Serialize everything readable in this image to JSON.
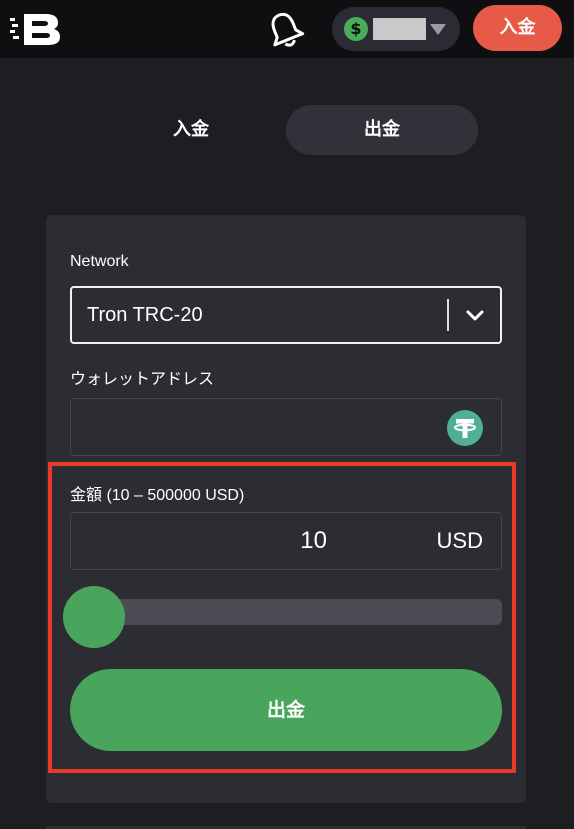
{
  "header": {
    "logo_icon": "brand-logo-icon",
    "bell_icon": "bell-icon",
    "balance": {
      "currency_icon": "dollar-icon",
      "dropdown_icon": "caret-down-icon"
    },
    "deposit_button_label": "入金"
  },
  "tabs": [
    {
      "label": "入金",
      "active": false
    },
    {
      "label": "出金",
      "active": true
    }
  ],
  "form": {
    "network_label": "Network",
    "network_value": "Tron TRC-20",
    "network_dropdown_icon": "chevron-down-icon",
    "wallet_label": "ウォレットアドレス",
    "wallet_value": "",
    "wallet_icon": "tether-icon",
    "amount_label": "金額 (10 – 500000 USD)",
    "amount_value": "10",
    "amount_unit": "USD",
    "slider_level": 0,
    "submit_label": "出金"
  },
  "colors": {
    "accent_green": "#4aa55c",
    "deposit_red": "#e75a47",
    "highlight_red": "#e8392b",
    "background": "#1d1e22",
    "card": "#2c2d33"
  }
}
